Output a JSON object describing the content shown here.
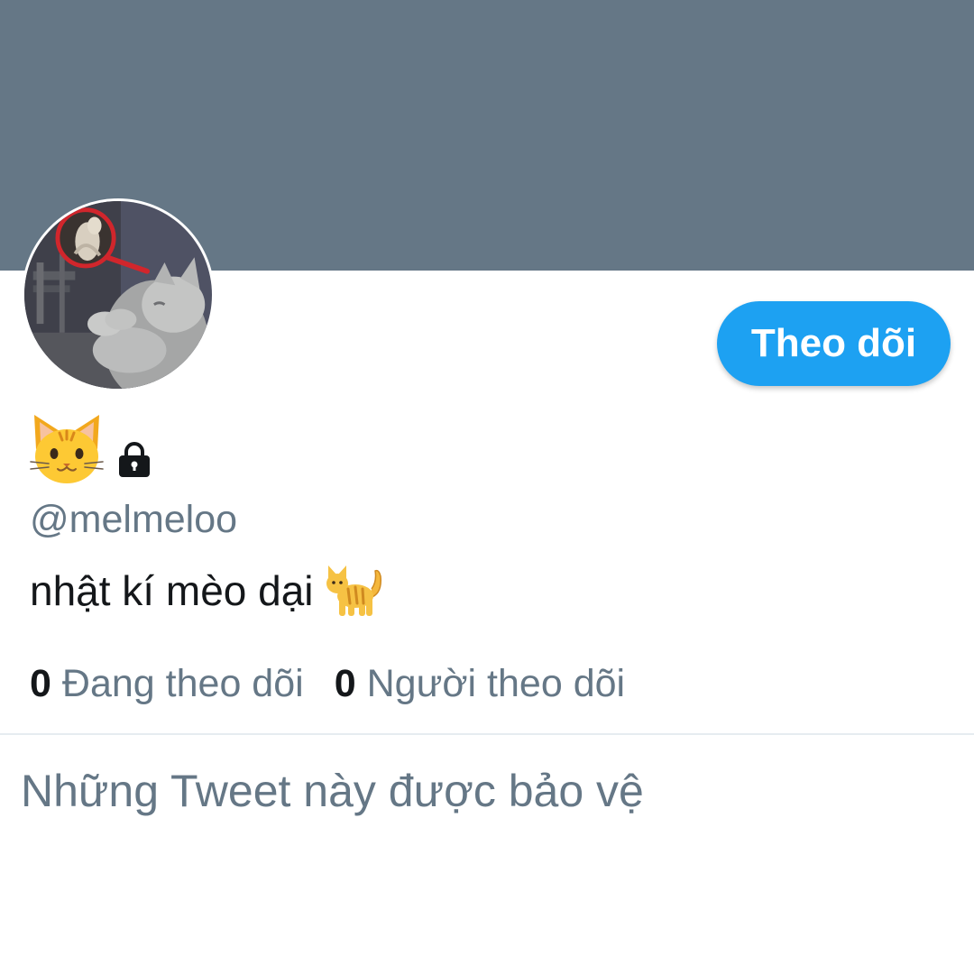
{
  "colors": {
    "banner": "#657786",
    "accent": "#1da1f2",
    "secondary_text": "#657786",
    "primary_text": "#14171a",
    "divider": "#e6ecf0"
  },
  "profile": {
    "avatar_icon": "cat-photo-avatar",
    "display_name_icon": "cat-face-emoji",
    "protected_icon": "lock-icon",
    "handle": "@melmeloo",
    "bio": "nhật kí mèo dại",
    "bio_icon": "cat-emoji"
  },
  "follow_button": {
    "label": "Theo dõi"
  },
  "stats": {
    "following": {
      "count": "0",
      "label": "Đang theo dõi"
    },
    "followers": {
      "count": "0",
      "label": "Người theo dõi"
    }
  },
  "notice": {
    "text": "Những Tweet này được bảo vệ"
  }
}
